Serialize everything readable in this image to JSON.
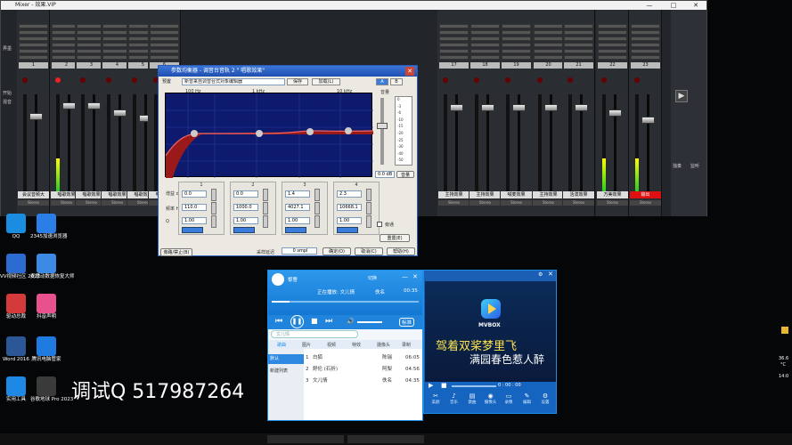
{
  "mixer": {
    "title": "Mixer - 效果.VIP",
    "side_labels": [
      "弄墨",
      "开始",
      "混音"
    ],
    "strips": [
      {
        "num": "1",
        "name": "会议音频大",
        "out": "Stereo",
        "rec": false,
        "meter": 0.0
      },
      {
        "num": "2",
        "name": "唱歌效果",
        "out": "Stereo",
        "rec": true,
        "meter": 0.35
      },
      {
        "num": "3",
        "name": "唱歌效果",
        "out": "Stereo",
        "rec": false,
        "meter": 0.0
      },
      {
        "num": "4",
        "name": "唱歌效果",
        "out": "Stereo",
        "rec": false,
        "meter": 0.0
      },
      {
        "num": "5",
        "name": "唱歌效果",
        "out": "Stereo",
        "rec": false,
        "meter": 0.0
      },
      {
        "num": "6",
        "name": "电音效果",
        "out": "Stereo",
        "rec": false,
        "meter": 0.0
      },
      {
        "num": "17",
        "name": "主持效果",
        "out": "Stereo",
        "rec": false,
        "meter": 0.0
      },
      {
        "num": "18",
        "name": "主持效果",
        "out": "Stereo",
        "rec": false,
        "meter": 0.0
      },
      {
        "num": "19",
        "name": "喊麦效果",
        "out": "Stereo",
        "rec": false,
        "meter": 0.0
      },
      {
        "num": "20",
        "name": "主持效果",
        "out": "Stereo",
        "rec": false,
        "meter": 0.0
      },
      {
        "num": "21",
        "name": "活泼效果",
        "out": "Stereo",
        "rec": false,
        "meter": 0.0
      },
      {
        "num": "22",
        "name": "万美效果",
        "out": "Stereo",
        "rec": false,
        "meter": 0.35
      },
      {
        "num": "23",
        "name": "输出",
        "out": "Stereo",
        "rec": false,
        "meter": 0.35
      }
    ],
    "right_labels": [
      "独奏",
      "监听"
    ]
  },
  "eq": {
    "title": "参数均衡器 - 调音台音轨 2 \" 唱歌效果\"",
    "preset_label": "预置",
    "preset_value": "新音来自调音台式对象编辑器",
    "buttons": {
      "save": "保存",
      "add": "加载(L)",
      "A": "A",
      "B": "B"
    },
    "freq_labels": [
      "100 Hz",
      "1 kHz",
      "10 kHz"
    ],
    "gain_label": "音量",
    "gain_value": "0.0 dB",
    "gain_button": "音量",
    "gain_scale": [
      "0",
      "-3",
      "-6",
      "-10",
      "-15",
      "-20",
      "-25",
      "-30",
      "-40",
      "-50"
    ],
    "row_labels": [
      "增益 dB",
      "频率 Hz",
      "Q"
    ],
    "bands": [
      {
        "num": "1",
        "gain": "0.0",
        "freq": "110.0",
        "q": "1.00"
      },
      {
        "num": "2",
        "gain": "0.0",
        "freq": "1000.0",
        "q": "1.00"
      },
      {
        "num": "3",
        "gain": "1.4",
        "freq": "4027.1",
        "q": "1.00"
      },
      {
        "num": "4",
        "gain": "2.3",
        "freq": "10668.1",
        "q": "1.00"
      }
    ],
    "bypass_label": "旁通",
    "reset_button": "重置(E)",
    "latency_label": "采样延迟",
    "latency_value": "0 smpl",
    "bottom_left": "旁路/禁止(B)",
    "ok": "确定(O)",
    "cancel": "取消(C)",
    "help": "帮助(H)"
  },
  "desktop": {
    "icons": [
      {
        "label": "QQ",
        "color": "#1a8de0"
      },
      {
        "label": "2345加速浏览器",
        "color": "#2a7ee6"
      },
      {
        "label": "VV视频社区 2022",
        "color": "#2c6bd0"
      },
      {
        "label": "麦思动数据恢复大师",
        "color": "#3b8be6"
      },
      {
        "label": "驱动总裁",
        "color": "#d43a3a"
      },
      {
        "label": "抖音声明",
        "color": "#e8508e"
      },
      {
        "label": "Word 2016",
        "color": "#2b5797"
      },
      {
        "label": "腾讯电脑管家",
        "color": "#1f7be0"
      },
      {
        "label": "实用工具",
        "color": "#1e88e5"
      },
      {
        "label": "谷歌地球 Pro 2023",
        "color": "#3a3a3a"
      }
    ],
    "watermark": "调试Q 517987264"
  },
  "player": {
    "user": "黎曹",
    "now_playing_label": "正在播放: 文儿情",
    "artist": "佚名",
    "time": "00:35",
    "quality": "标准",
    "search_placeholder": "文儿情",
    "tabs": [
      "歌曲",
      "图片",
      "视频",
      "特效",
      "摄像头",
      "录制"
    ],
    "side_items": [
      "默认",
      "新建列表"
    ],
    "rows": [
      {
        "num": "1",
        "title": "白狐",
        "artist": "陈瑞",
        "dur": "06:05"
      },
      {
        "num": "2",
        "title": "舒伦 (石折)",
        "artist": "阿梨",
        "dur": "04:56"
      },
      {
        "num": "3",
        "title": "文儿情",
        "artist": "佚名",
        "dur": "04:35"
      }
    ],
    "header_btns": [
      "切换",
      "最小",
      "关闭"
    ]
  },
  "mv": {
    "brand": "MVBOX",
    "lyric1": "驾着双桨梦里飞",
    "lyric2": "满园春色惹人醉",
    "time": "0 : 00 : 00",
    "buttons": [
      "美颜",
      "音乐",
      "歌曲",
      "摄像头",
      "录像",
      "编辑",
      "设置"
    ]
  },
  "tray": {
    "temp": "36.6",
    "unit": "°C",
    "time": "14:0"
  },
  "colors": {
    "eq_graph_bg": "#0e1a6e",
    "eq_curve_fill": "#9a1a1a",
    "player_blue": "#1b8ce8"
  }
}
